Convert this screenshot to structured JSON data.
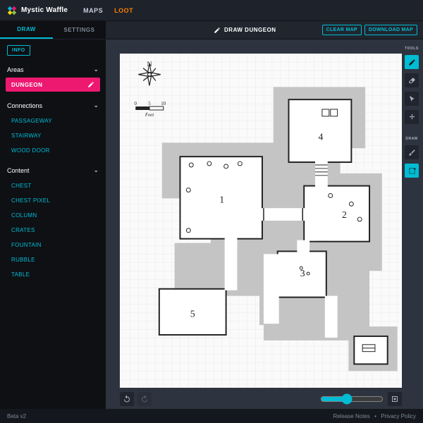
{
  "app": {
    "name": "Mystic Waffle"
  },
  "topnav": {
    "maps": "MAPS",
    "loot": "LOOT"
  },
  "sidebar": {
    "tabs": {
      "draw": "DRAW",
      "settings": "SETTINGS"
    },
    "info_btn": "INFO",
    "areas": {
      "title": "Areas",
      "active": "DUNGEON"
    },
    "connections": {
      "title": "Connections",
      "items": [
        "PASSAGEWAY",
        "STAIRWAY",
        "WOOD DOOR"
      ]
    },
    "content": {
      "title": "Content",
      "items": [
        "CHEST",
        "CHEST PIXEL",
        "COLUMN",
        "CRATES",
        "FOUNTAIN",
        "RUBBLE",
        "TABLE"
      ]
    }
  },
  "header": {
    "title": "DRAW DUNGEON",
    "clear": "CLEAR MAP",
    "download": "DOWNLOAD MAP"
  },
  "toolbox": {
    "tools_label": "TOOLS",
    "draw_label": "DRAW"
  },
  "map": {
    "compass_label": "N",
    "scale_ticks": [
      "0",
      "5",
      "10"
    ],
    "scale_unit": "Feet",
    "room_labels": [
      "1",
      "2",
      "3",
      "4",
      "5"
    ]
  },
  "zoom": {
    "value": 40,
    "min": 0,
    "max": 100
  },
  "footer": {
    "version": "Beta v2",
    "release_notes": "Release Notes",
    "privacy": "Privacy Policy"
  },
  "colors": {
    "accent_cyan": "#00bcd4",
    "accent_orange": "#ff7f00",
    "accent_pink": "#ed1970",
    "panel_dark": "#0e1014",
    "panel_mid": "#20252e"
  }
}
